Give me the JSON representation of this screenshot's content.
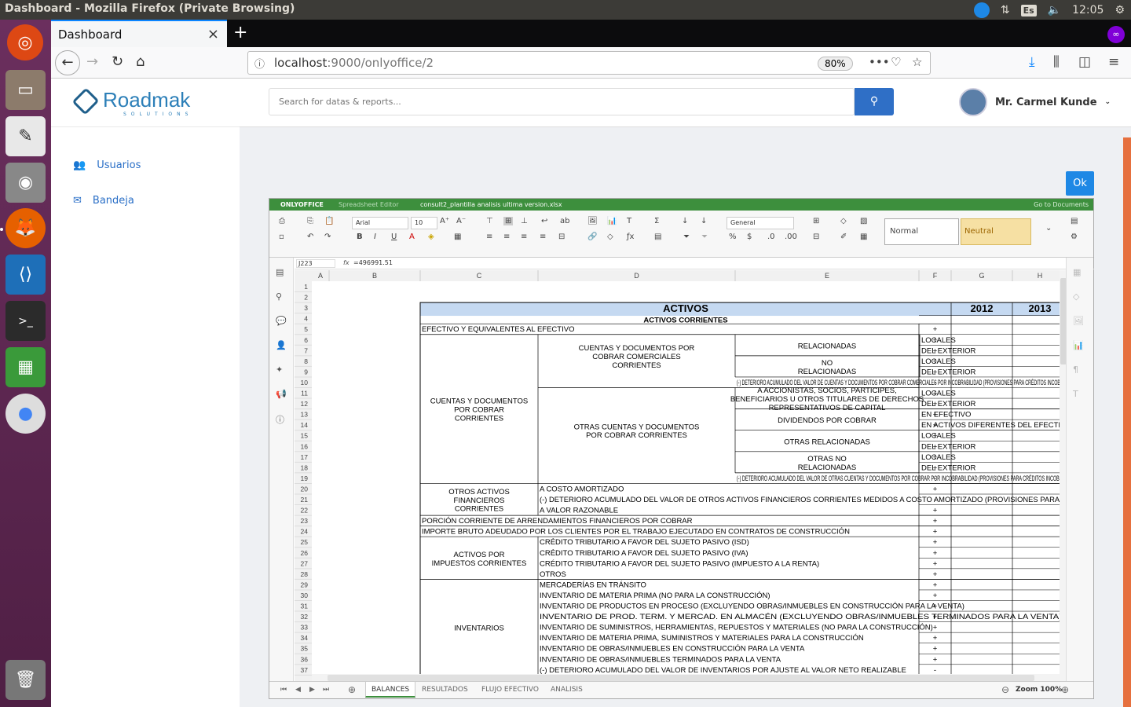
{
  "os": {
    "window_title": "Dashboard - Mozilla Firefox (Private Browsing)",
    "keyboard_layout": "Es",
    "clock": "12:05"
  },
  "browser": {
    "tab_title": "Dashboard",
    "url_host": "localhost",
    "url_path": ":9000/onlyoffice/2",
    "zoom": "80%"
  },
  "app": {
    "brand": "Roadmak",
    "brand_sub": "SOLUTIONS",
    "nav": [
      {
        "label": "Usuarios",
        "icon": "users-icon"
      },
      {
        "label": "Bandeja",
        "icon": "envelope-icon"
      }
    ],
    "search_placeholder": "Search for datas & reports...",
    "user_name": "Mr. Carmel Kunde",
    "ok_label": "Ok"
  },
  "editor": {
    "product": "ONLYOFFICE",
    "product_sub": "Spreadsheet Editor",
    "file_name": "consult2_plantilla analisis ultima version.xlsx",
    "go_to_docs": "Go to Documents",
    "font_name": "Arial",
    "font_size": "10",
    "number_format": "General",
    "style_normal": "Normal",
    "style_neutral": "Neutral",
    "cell_ref": "J223",
    "fx": "fx",
    "formula": "=496991.51",
    "zoom": "Zoom 100%",
    "sheet_tabs": [
      "BALANCES",
      "RESULTADOS",
      "FLUJO EFECTIVO",
      "ANALISIS"
    ],
    "columns": [
      "A",
      "B",
      "C",
      "D",
      "E",
      "F",
      "G",
      "H"
    ],
    "header": {
      "title": "ACTIVOS",
      "y1": "2012",
      "y2": "2013",
      "subtitle": "ACTIVOS CORRIENTES"
    },
    "row_numbers": [
      "1",
      "2",
      "3",
      "4",
      "5",
      "6",
      "7",
      "8",
      "9",
      "10",
      "11",
      "12",
      "13",
      "14",
      "15",
      "16",
      "17",
      "18",
      "19",
      "20",
      "21",
      "22",
      "23",
      "24",
      "25",
      "26",
      "27",
      "28",
      "29",
      "30",
      "31",
      "32",
      "33",
      "34",
      "35",
      "36",
      "37"
    ],
    "groups": {
      "cxc": "CUENTAS Y DOCUMENTOS POR COBRAR CORRIENTES",
      "cyd_comerciales": "CUENTAS Y DOCUMENTOS POR COBRAR COMERCIALES CORRIENTES",
      "otras_cyd": "OTRAS CUENTAS Y DOCUMENTOS POR COBRAR CORRIENTES",
      "otros_activos_fin": "OTROS ACTIVOS FINANCIEROS CORRIENTES",
      "activos_impuestos": "ACTIVOS POR IMPUESTOS CORRIENTES",
      "inventarios": "INVENTARIOS",
      "relacionadas": "RELACIONADAS",
      "no_relacionadas": "NO RELACIONADAS",
      "accionistas": "A ACCIONISTAS, SOCIOS, PARTICIPES, BENEFICIARIOS U OTROS TITULARES DE DERECHOS REPRESENTATIVOS DE CAPITAL",
      "dividendos": "DIVIDENDOS POR COBRAR",
      "otras_relacionadas": "OTRAS RELACIONADAS",
      "otras_no_relacionadas": "OTRAS NO RELACIONADAS"
    },
    "rows": {
      "r5": "EFECTIVO Y EQUIVALENTES AL EFECTIVO",
      "locales": "LOCALES",
      "exterior": "DEL EXTERIOR",
      "r10": "(-) DETERIORO ACUMULADO DEL VALOR DE CUENTAS Y DOCUMENTOS POR COBRAR COMERCIALES POR INCOBRABILIDAD (PROVISIONES PARA CRÉDITOS INCOBRABLES)",
      "r13": "EN EFECTIVO",
      "r14": "EN ACTIVOS DIFERENTES DEL EFECTIVO",
      "r19": "(-) DETERIORO ACUMULADO DEL VALOR DE OTRAS CUENTAS Y DOCUMENTOS POR COBRAR POR INCOBRABILIDAD (PROVISIONES PARA CRÉDITOS INCOBRABLES)",
      "r20": "A COSTO AMORTIZADO",
      "r21": "(-) DETERIORO ACUMULADO DEL VALOR  DE OTROS ACTIVOS FINANCIEROS CORRIENTES MEDIDOS A COSTO AMORTIZADO  (PROVISIONES PARA CRÉDITOS INCOBRABLES)",
      "r22": "A VALOR RAZONABLE",
      "r23": "PORCIÓN CORRIENTE DE ARRENDAMIENTOS FINANCIEROS POR COBRAR",
      "r24": "IMPORTE BRUTO ADEUDADO POR LOS CLIENTES POR EL TRABAJO EJECUTADO EN CONTRATOS DE CONSTRUCCIÓN",
      "r25": "CRÉDITO TRIBUTARIO A FAVOR DEL SUJETO PASIVO (ISD)",
      "r26": "CRÉDITO TRIBUTARIO A FAVOR DEL SUJETO PASIVO (IVA)",
      "r27": "CRÉDITO TRIBUTARIO A FAVOR DEL SUJETO PASIVO (IMPUESTO A LA RENTA)",
      "r28": "OTROS",
      "r29": "MERCADERÍAS EN TRÁNSITO",
      "r30": "INVENTARIO DE MATERIA PRIMA (NO PARA LA CONSTRUCCIÓN)",
      "r31": "INVENTARIO DE PRODUCTOS EN PROCESO (EXCLUYENDO OBRAS/INMUEBLES EN CONSTRUCCIÓN PARA LA VENTA)",
      "r32": "INVENTARIO DE PROD. TERM. Y MERCAD. EN ALMACÉN (EXCLUYENDO OBRAS/INMUEBLES  TERMINADOS PARA LA VENTA)",
      "r33": "INVENTARIO DE SUMINISTROS, HERRAMIENTAS, REPUESTOS Y MATERIALES (NO PARA LA CONSTRUCCIÓN)",
      "r34": "INVENTARIO DE MATERIA PRIMA, SUMINISTROS Y MATERIALES PARA LA CONSTRUCCIÓN",
      "r35": "INVENTARIO DE OBRAS/INMUEBLES EN CONSTRUCCIÓN PARA LA VENTA",
      "r36": "INVENTARIO DE OBRAS/INMUEBLES TERMINADOS PARA LA VENTA",
      "r37": "(-) DETERIORO ACUMULADO DEL VALOR DE INVENTARIOS POR AJUSTE AL VALOR NETO REALIZABLE"
    },
    "signs": {
      "plus": "+",
      "minus": "-"
    }
  }
}
